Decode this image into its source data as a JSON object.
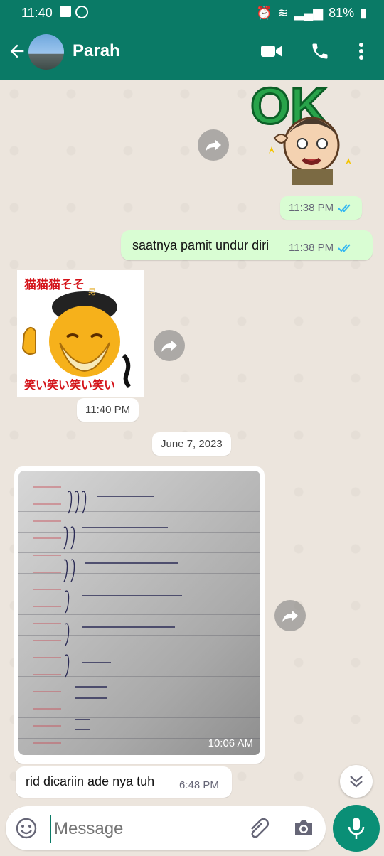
{
  "status": {
    "time": "11:40",
    "battery": "81%"
  },
  "header": {
    "contact_name": "Parah"
  },
  "messages": [
    {
      "id": "m1",
      "direction": "outgoing",
      "type": "sticker",
      "sticker_text": "OK",
      "time": "11:38 PM",
      "ticks": "read"
    },
    {
      "id": "m2",
      "direction": "outgoing",
      "type": "text",
      "text": "saatnya pamit undur diri",
      "time": "11:38 PM",
      "ticks": "read"
    },
    {
      "id": "m3",
      "direction": "incoming",
      "type": "sticker",
      "sticker_top": "猫猫猫そそ",
      "sticker_bottom": "笑い笑い笑い笑い",
      "sticker_hat": "男",
      "time": "11:40 PM"
    },
    {
      "id": "m4",
      "direction": "incoming",
      "type": "image",
      "time": "10:06 AM"
    },
    {
      "id": "m5",
      "direction": "incoming",
      "type": "text",
      "text": "rid dicariin ade nya tuh",
      "time": "6:48 PM"
    }
  ],
  "date_chip": "June 7, 2023",
  "composer": {
    "placeholder": "Message"
  },
  "colors": {
    "header": "#0a7a66",
    "outgoing_bubble": "#d9fdd3",
    "read_tick": "#34b7f1",
    "mic_button": "#0a8f76"
  }
}
